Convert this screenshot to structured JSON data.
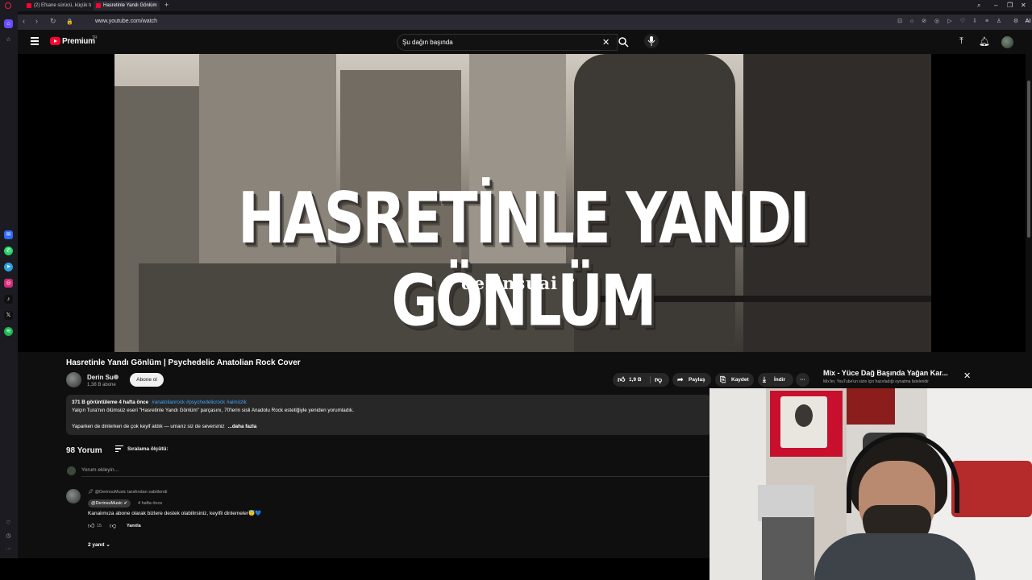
{
  "browser": {
    "tabs": [
      {
        "label": "(2) Efsane sürücü, küçük tı"
      },
      {
        "label": "Hasretinle Yandı Gönlüm"
      }
    ],
    "new_tab_glyph": "+",
    "url": "www.youtube.com/watch",
    "ai_label": "AI"
  },
  "youtube_header": {
    "logo_text": "Premium",
    "region": "TR",
    "search_value": "Şu dağın başında"
  },
  "video": {
    "overlay_title": "HASRETİNLE YANDI GÖNLÜM",
    "overlay_signature": "derinsuai ♪"
  },
  "watch": {
    "title": "Hasretinle Yandı Gönlüm | Psychedelic Anatolian Rock Cover",
    "channel_name": "Derin Su",
    "subscribers": "1,38 B abone",
    "subscribe_label": "Abone ol",
    "likes": "1,9 B",
    "share_label": "Paylaş",
    "save_label": "Kaydet",
    "download_label": "İndir",
    "more_glyph": "···"
  },
  "mix_panel": {
    "title": "Mix - Yüce Dağ Başında Yağan Kar...",
    "subtitle": "Mix'ler, YouTube'un sizin için hazırladığı oynatma listeleridir"
  },
  "description": {
    "meta": "371 B görüntüleme  4 hafta önce",
    "tags": "#anatolianrock #psychedelicrock #aimüzik",
    "line1": "Yalçın Tura'nın ölümsüz eseri \"Hasretinle Yandı Gönlüm\" parçasını, 70'lerin sisli Anadolu Rock estetiğiyle yeniden yorumladık.",
    "line2": "Yaparken de dinlerken de çok keyif aldık — umarız siz de seversiniz",
    "more_label": "...daha fazla"
  },
  "comments": {
    "count_label": "98 Yorum",
    "sort_label": "Sıralama ölçütü:",
    "add_placeholder": "Yorum ekleyin...",
    "pinned": {
      "pinned_by": "@DerinsuMusic tarafından sabitlendi",
      "author": "@DerinsuMusic",
      "time": "4 hafta önce",
      "text": "Kanalımıza abone olarak bizlere destek olabilirsiniz, keyifli dinlemeler😇💙",
      "likes": "15",
      "reply_label": "Yanıtla",
      "replies_label": "2 yanıt"
    }
  },
  "colors": {
    "yt_red": "#ff0033",
    "background": "#0f0f0f",
    "link_blue": "#3ea6ff"
  }
}
